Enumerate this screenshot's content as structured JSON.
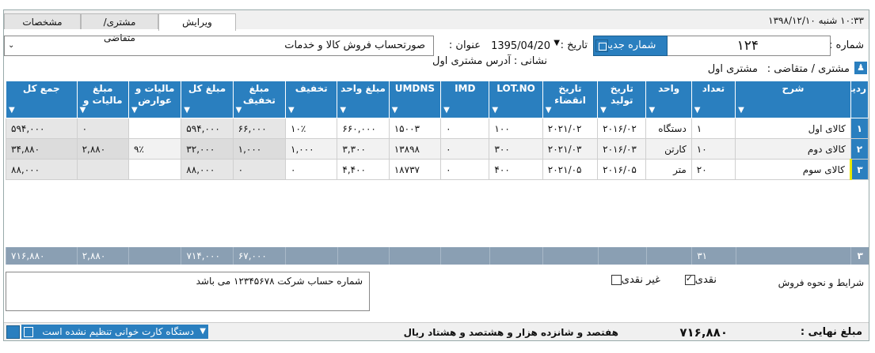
{
  "clock": "۱۰:۳۳  شنبه  ۱۳۹۸/۱۲/۱۰",
  "tabs": [
    "ویرایش",
    "مشتری/متقاضی",
    "مشخصات"
  ],
  "header": {
    "number_label": "شماره :",
    "number_value": "۱۲۴",
    "new_number_button": "شماره جدید",
    "date_label": "تاریخ :",
    "date_value": "1395/04/20",
    "title_label": "عنوان :",
    "title_value": "صورتحساب فروش کالا و خدمات",
    "customer_label": "مشتری / متقاضی :",
    "customer_value": "مشتری اول",
    "address_label": "نشانی :",
    "address_value": "آدرس مشتری اول"
  },
  "grid": {
    "columns": [
      "ردیف",
      "شرح",
      "تعداد",
      "واحد",
      "تاریخ تولید",
      "تاریخ انقضاء",
      "LOT.NO",
      "IMD",
      "UMDNS",
      "مبلغ واحد",
      "تخفیف",
      "مبلغ تخفیف",
      "مبلغ کل",
      "مالیات و عوارض",
      "مبلغ مالیات و",
      "جمع کل"
    ],
    "rows": [
      [
        "۱",
        "کالای اول",
        "۱",
        "دستگاه",
        "۲۰۱۶/۰۲",
        "۲۰۲۱/۰۲",
        "۱۰۰",
        "۰",
        "۱۵۰۰۳",
        "۶۶۰,۰۰۰",
        "۱۰٪",
        "۶۶,۰۰۰",
        "۵۹۴,۰۰۰",
        "",
        "۰",
        "۵۹۴,۰۰۰"
      ],
      [
        "۲",
        "کالای دوم",
        "۱۰",
        "کارتن",
        "۲۰۱۶/۰۳",
        "۲۰۲۱/۰۳",
        "۳۰۰",
        "۰",
        "۱۳۸۹۸",
        "۳,۳۰۰",
        "۱,۰۰۰",
        "۱,۰۰۰",
        "۳۲,۰۰۰",
        "۹٪",
        "۲,۸۸۰",
        "۳۴,۸۸۰"
      ],
      [
        "۳",
        "کالای سوم",
        "۲۰",
        "متر",
        "۲۰۱۶/۰۵",
        "۲۰۲۱/۰۵",
        "۴۰۰",
        "۰",
        "۱۸۷۳۷",
        "۴,۴۰۰",
        "۰",
        "۰",
        "۸۸,۰۰۰",
        "",
        "",
        "۸۸,۰۰۰"
      ]
    ],
    "totals": [
      "۳",
      "",
      "۳۱",
      "",
      "",
      "",
      "",
      "",
      "",
      "",
      "",
      "۶۷,۰۰۰",
      "۷۱۴,۰۰۰",
      "",
      "۲,۸۸۰",
      "۷۱۶,۸۸۰"
    ]
  },
  "note_value": "شماره حساب شرکت ۱۲۳۴۵۶۷۸ می باشد",
  "terms_label": "شرایط و نحوه فروش",
  "cash_label": "نقدی",
  "noncash_label": "غیر نقدی",
  "final_label": "مبلغ نهایی :",
  "final_value": "۷۱۶,۸۸۰",
  "final_words": "هفتصد و شانزده هزار و هشتصد و هشتاد ریال",
  "status_text": "دستگاه کارت خوانی تنظیم نشده است",
  "colors": {
    "accent": "#2a7fbf",
    "totals": "#8a9fb3",
    "selected_marker": "#e8e800"
  }
}
